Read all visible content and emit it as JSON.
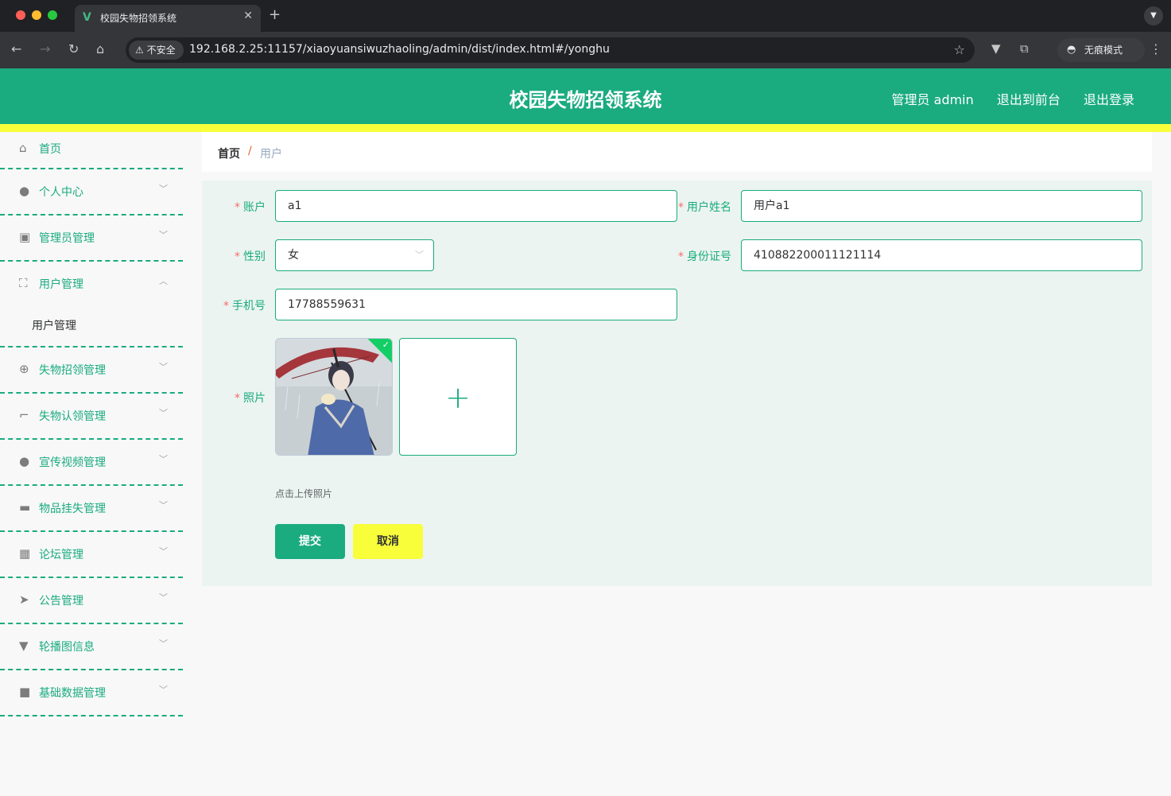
{
  "browser": {
    "tab_title": "校园失物招领系统",
    "tab_logo": "V",
    "security_label": "不安全",
    "url": "192.168.2.25:11157/xiaoyuansiwuzhaoling/admin/dist/index.html#/yonghu",
    "incognito_label": "无痕模式"
  },
  "header": {
    "title": "校园失物招领系统",
    "user": "管理员 admin",
    "to_front": "退出到前台",
    "logout": "退出登录"
  },
  "sidebar": {
    "items": [
      {
        "label": "首页",
        "icon": "home-icon"
      },
      {
        "label": "个人中心",
        "icon": "user-icon"
      },
      {
        "label": "管理员管理",
        "icon": "clipboard-icon"
      },
      {
        "label": "用户管理",
        "icon": "frame-icon"
      },
      {
        "label": "失物招领管理",
        "icon": "target-icon"
      },
      {
        "label": "失物认领管理",
        "icon": "crop-icon"
      },
      {
        "label": "宣传视频管理",
        "icon": "user-icon"
      },
      {
        "label": "物品挂失管理",
        "icon": "briefcase-icon"
      },
      {
        "label": "论坛管理",
        "icon": "grid-icon"
      },
      {
        "label": "公告管理",
        "icon": "send-icon"
      },
      {
        "label": "轮播图信息",
        "icon": "brush-icon"
      },
      {
        "label": "基础数据管理",
        "icon": "camera-icon"
      }
    ],
    "submenu_label": "用户管理"
  },
  "breadcrumb": {
    "home": "首页",
    "separator": "/",
    "current": "用户"
  },
  "form": {
    "account_label": "账户",
    "account_value": "a1",
    "name_label": "用户姓名",
    "name_value": "用户a1",
    "gender_label": "性别",
    "gender_value": "女",
    "id_label": "身份证号",
    "id_value": "410882200011121114",
    "phone_label": "手机号",
    "phone_value": "17788559631",
    "photo_label": "照片",
    "upload_tip": "点击上传照片",
    "submit": "提交",
    "cancel": "取消"
  },
  "colors": {
    "brand": "#1aab7f",
    "accent_yellow": "#f8ff3a",
    "required": "#f56c6c"
  }
}
